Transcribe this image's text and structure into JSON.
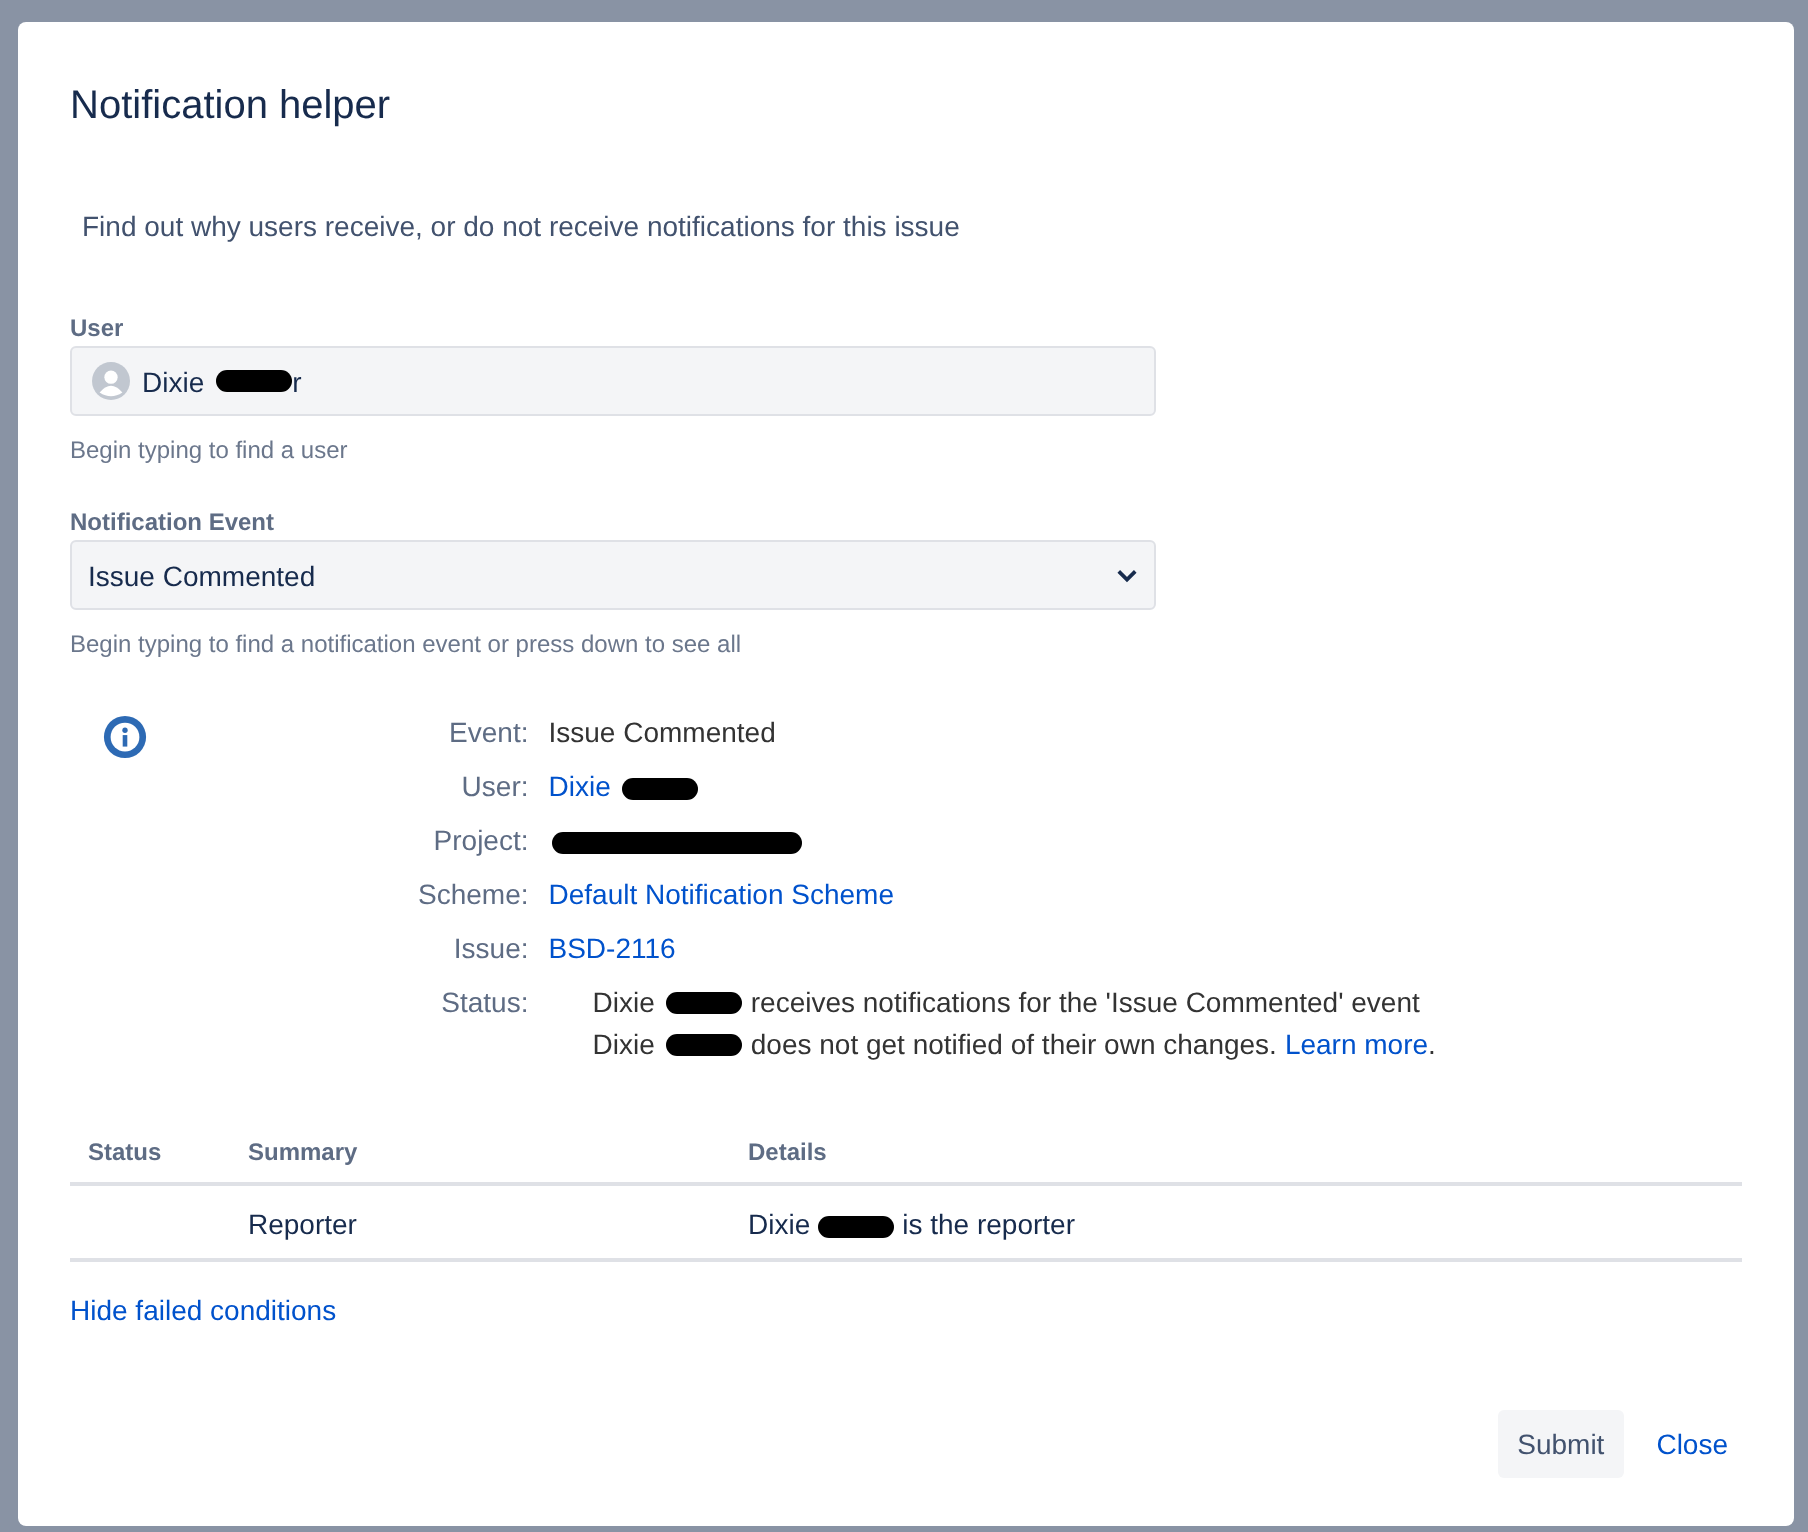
{
  "dialog": {
    "title": "Notification helper",
    "description": "Find out why users receive, or do not receive notifications for this issue"
  },
  "user_field": {
    "label": "User",
    "value": "Dixie",
    "redacted": true,
    "tail": "r",
    "help": "Begin typing to find a user"
  },
  "event_field": {
    "label": "Notification Event",
    "value": "Issue Commented",
    "help": "Begin typing to find a notification event or press down to see all"
  },
  "details": [
    {
      "label": "Event:",
      "kind": "text",
      "value": "Issue Commented"
    },
    {
      "label": "User:",
      "kind": "link",
      "value": "Dixie",
      "redacted": true
    },
    {
      "label": "Project:",
      "kind": "link",
      "redacted": true
    },
    {
      "label": "Scheme:",
      "kind": "link",
      "value": "Default Notification Scheme"
    },
    {
      "label": "Issue:",
      "kind": "link",
      "value": "BSD-2116"
    },
    {
      "label": "Status:",
      "kind": "status",
      "lines": [
        {
          "before": "Dixie",
          "redacted": true,
          "after": "receives notifications for the 'Issue Commented' event"
        },
        {
          "before": "Dixie",
          "redacted": true,
          "after": "does not get notified of their own changes.",
          "link": "Learn more",
          "end": "."
        }
      ]
    }
  ],
  "table": {
    "columns": [
      "Status",
      "Summary",
      "Details"
    ],
    "rows": [
      {
        "summary": "Reporter",
        "details": {
          "before": "Dixie",
          "redacted": true,
          "after": "is the reporter"
        }
      }
    ]
  },
  "toggle_link": "Hide failed conditions",
  "buttons": [
    {
      "label": "Submit",
      "kind": "primary"
    },
    {
      "label": "Close",
      "kind": "link"
    }
  ]
}
